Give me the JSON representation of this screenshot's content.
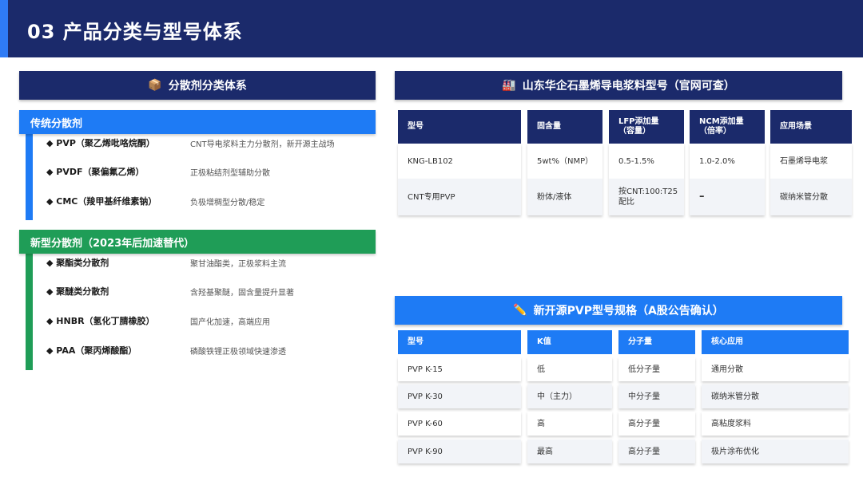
{
  "header": {
    "title": "03  产品分类与型号体系"
  },
  "left": {
    "panel_title": "分散剂分类体系",
    "panel_icon": "📦",
    "traditional": {
      "title": "传统分散剂",
      "items": [
        {
          "name": "◆ PVP（聚乙烯吡咯烷酮）",
          "desc": "CNT导电浆料主力分散剂，新开源主战场"
        },
        {
          "name": "◆ PVDF（聚偏氟乙烯）",
          "desc": "正极粘结剂型辅助分散"
        },
        {
          "name": "◆ CMC（羧甲基纤维素钠）",
          "desc": "负极增稠型分散/稳定"
        }
      ]
    },
    "new_type": {
      "title": "新型分散剂（2023年后加速替代）",
      "items": [
        {
          "name": "◆ 聚酯类分散剂",
          "desc": "聚甘油酯类，正极浆料主流"
        },
        {
          "name": "◆ 聚醚类分散剂",
          "desc": "含羟基聚醚，固含量提升显著"
        },
        {
          "name": "◆ HNBR（氢化丁腈橡胶）",
          "desc": "国产化加速，高端应用"
        },
        {
          "name": "◆ PAA（聚丙烯酸酯）",
          "desc": "磷酸铁锂正极领域快速渗透"
        }
      ]
    }
  },
  "right_top": {
    "panel_title": "山东华企石墨烯导电浆料型号（官网可查）",
    "panel_icon": "🏭",
    "headers": [
      "型号",
      "固含量",
      "LFP添加量\n（容量）",
      "NCM添加量\n（倍率）",
      "应用场景"
    ],
    "rows": [
      [
        "KNG-LB102",
        "5wt%（NMP）",
        "0.5-1.5%",
        "1.0-2.0%",
        "石墨烯导电浆"
      ],
      [
        "CNT专用PVP",
        "粉体/液体",
        "按CNT:100:T25配比",
        "–",
        "碳纳米管分散"
      ]
    ]
  },
  "right_bottom": {
    "panel_title": "新开源PVP型号规格（A股公告确认）",
    "panel_icon": "✏️",
    "headers": [
      "型号",
      "K值",
      "分子量",
      "核心应用"
    ],
    "rows": [
      [
        "PVP K-15",
        "低",
        "低分子量",
        "通用分散"
      ],
      [
        "PVP K-30",
        "中（主力）",
        "中分子量",
        "碳纳米管分散"
      ],
      [
        "PVP K-60",
        "高",
        "高分子量",
        "高粘度浆料"
      ],
      [
        "PVP K-90",
        "最高",
        "高分子量",
        "极片涂布优化"
      ]
    ]
  },
  "colors": {
    "navy": "#1b2a6b",
    "blue": "#1e7bf5",
    "green": "#1f9d57"
  }
}
